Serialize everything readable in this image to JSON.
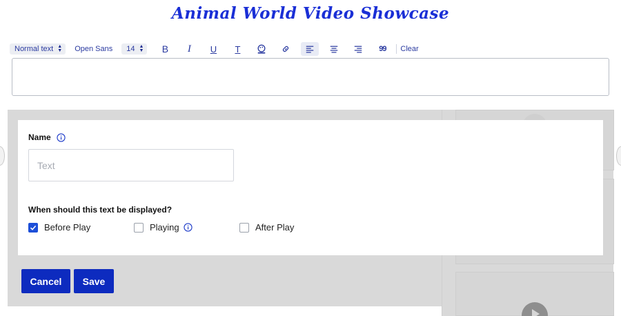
{
  "page": {
    "title": "Animal World Video Showcase"
  },
  "toolbar": {
    "paragraph_style": "Normal text",
    "font_family": "Open Sans",
    "font_size": "14",
    "clear_label": "Clear",
    "buttons": [
      {
        "icon": "bold-icon",
        "glyph": "B"
      },
      {
        "icon": "italic-icon",
        "glyph": "I"
      },
      {
        "icon": "underline-icon",
        "glyph": "U"
      },
      {
        "icon": "text-color-icon",
        "glyph": "T"
      },
      {
        "icon": "palette-icon"
      },
      {
        "icon": "link-icon"
      },
      {
        "icon": "align-left-icon",
        "active": true
      },
      {
        "icon": "align-center-icon"
      },
      {
        "icon": "align-right-icon"
      },
      {
        "icon": "quote-icon",
        "glyph": "99"
      }
    ]
  },
  "editor": {
    "value": ""
  },
  "form": {
    "name_label": "Name",
    "name_placeholder": "Text",
    "name_value": "",
    "when_label": "When should this text be displayed?",
    "options": [
      {
        "label": "Before Play",
        "checked": true,
        "info": false
      },
      {
        "label": "Playing",
        "checked": false,
        "info": true
      },
      {
        "label": "After Play",
        "checked": false,
        "info": false
      }
    ]
  },
  "actions": {
    "cancel_label": "Cancel",
    "save_label": "Save"
  },
  "colors": {
    "title": "#1a2fd6",
    "primary_button": "#0d2bbf",
    "checkbox_checked": "#1d4fd8",
    "toolbar_text": "#2a3aa0"
  }
}
